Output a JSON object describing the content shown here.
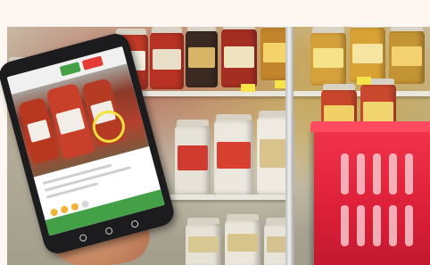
{
  "scene": {
    "description_colors": {
      "background": "#fdf6f1",
      "basket": "#dc1f38",
      "app_accent": "#43a047",
      "highlight": "#f4e23a"
    },
    "icons": [
      "phone-icon",
      "basket-icon",
      "highlight-circle-icon"
    ]
  }
}
